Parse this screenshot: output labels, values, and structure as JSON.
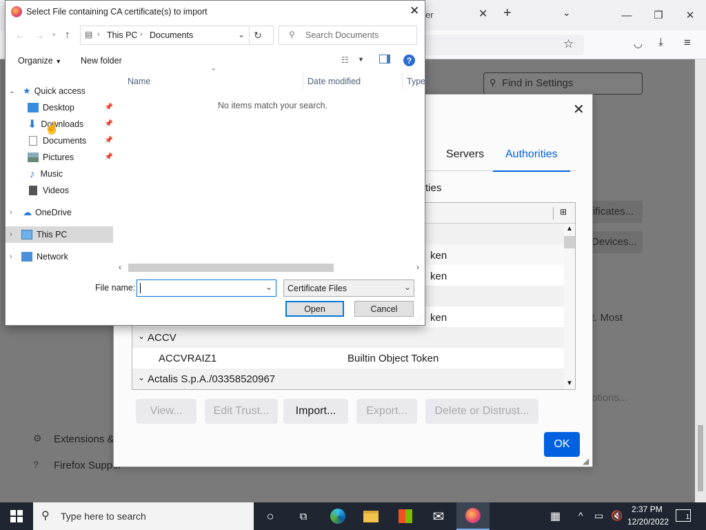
{
  "firefox": {
    "tab_fragment": "er",
    "find_placeholder": "Find in Settings",
    "sidebar_extensions": "Extensions & T",
    "sidebar_support": "Firefox Suppor",
    "bg_btn_certificates": "ificates...",
    "bg_btn_devices": "Devices...",
    "bg_text_most": "t. Most",
    "bg_btn_options": "ptions..."
  },
  "cert_manager": {
    "tabs": [
      "Servers",
      "Authorities"
    ],
    "selected_tab": "Authorities",
    "header_fragment": "ties",
    "token_fragments": [
      "ken",
      "ken",
      "ken"
    ],
    "tree": [
      {
        "type": "group",
        "label": "ACCV"
      },
      {
        "type": "item",
        "name": "ACCVRAIZ1",
        "token": "Builtin Object Token"
      },
      {
        "type": "group",
        "label": "Actalis S.p.A./03358520967"
      }
    ],
    "buttons": {
      "view": "View...",
      "edit_trust": "Edit Trust...",
      "import": "Import...",
      "export": "Export...",
      "delete": "Delete or Distrust..."
    },
    "ok": "OK"
  },
  "file_dialog": {
    "title": "Select File containing CA certificate(s) to import",
    "breadcrumb": [
      "This PC",
      "Documents"
    ],
    "search_placeholder": "Search Documents",
    "organize": "Organize",
    "new_folder": "New folder",
    "columns": [
      "Name",
      "Date modified",
      "Type"
    ],
    "empty_message": "No items match your search.",
    "nav": {
      "quick_access": "Quick access",
      "desktop": "Desktop",
      "downloads": "Downloads",
      "documents": "Documents",
      "pictures": "Pictures",
      "music": "Music",
      "videos": "Videos",
      "onedrive": "OneDrive",
      "this_pc": "This PC",
      "network": "Network"
    },
    "file_name_label": "File name:",
    "file_name_value": "",
    "file_type": "Certificate Files",
    "open": "Open",
    "cancel": "Cancel"
  },
  "taskbar": {
    "search_placeholder": "Type here to search",
    "time": "2:37 PM",
    "date": "12/20/2022",
    "notification_count": "1"
  },
  "colors": {
    "accent_blue": "#0061e0",
    "taskbar": "#1f2631",
    "selection": "#d9d9d9"
  }
}
